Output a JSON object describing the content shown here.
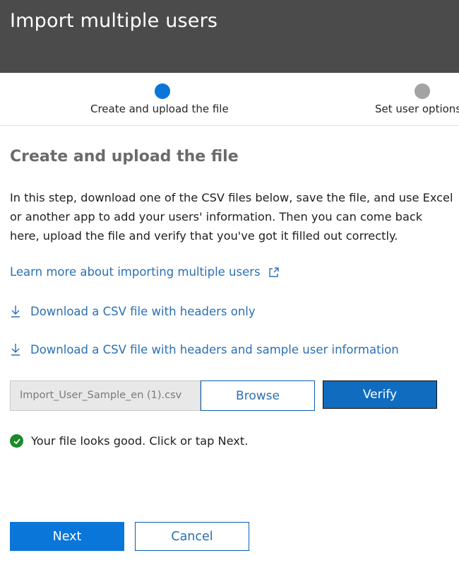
{
  "header": {
    "title": "Import multiple users",
    "background": "#4b4b4b"
  },
  "stepper": {
    "steps": [
      {
        "label": "Create and upload the file",
        "state": "active",
        "color": "#0a76d9"
      },
      {
        "label": "Set user options",
        "state": "inactive",
        "color": "#a3a3a3"
      }
    ]
  },
  "main": {
    "section_title": "Create and upload the file",
    "intro": "In this step, download one of the CSV files below, save the file, and use Excel or another app to add your users' information. Then you can come back here, upload the file and verify that you've got it filled out correctly.",
    "links": {
      "learn_more": "Learn more about importing multiple users",
      "download_headers": "Download a CSV file with headers only",
      "download_sample": "Download a CSV file with headers and sample user information"
    },
    "upload": {
      "file_name": "Import_User_Sample_en (1).csv",
      "browse_label": "Browse",
      "verify_label": "Verify"
    },
    "status": {
      "text": "Your file looks good. Click or tap Next.",
      "icon": "check-circle-icon",
      "color": "#1a8a2a"
    }
  },
  "footer": {
    "next_label": "Next",
    "cancel_label": "Cancel"
  },
  "colors": {
    "accent": "#0a76d9",
    "link": "#2a70b5"
  }
}
